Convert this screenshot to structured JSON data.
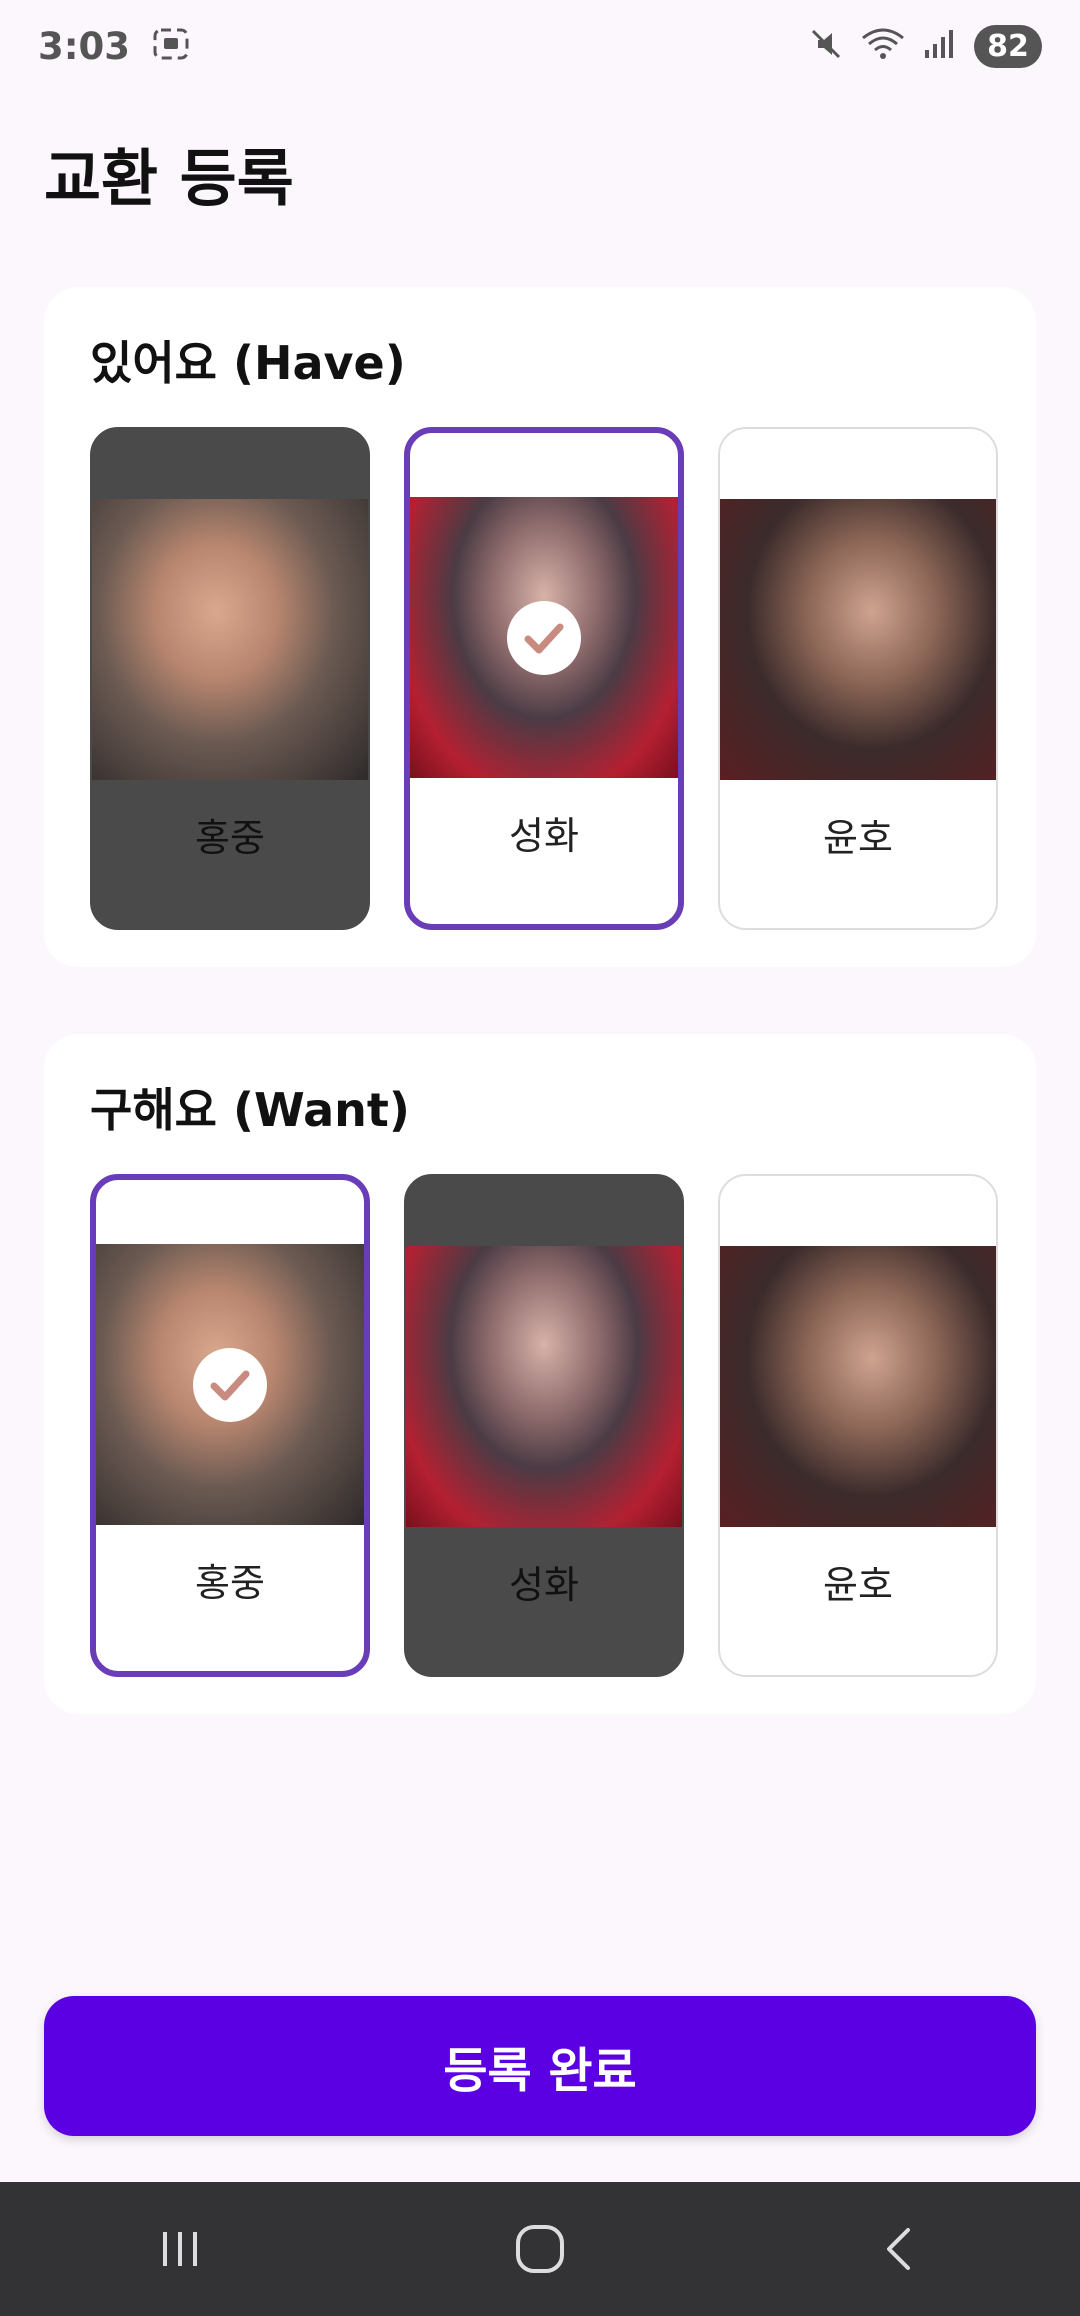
{
  "status_bar": {
    "time": "3:03",
    "battery": "82",
    "icons": [
      "screenshot-icon",
      "mute-icon",
      "wifi-icon",
      "signal-icon"
    ]
  },
  "page": {
    "title": "교환 등록"
  },
  "have_section": {
    "heading": "있어요 (Have)",
    "cards": [
      {
        "name": "홍중",
        "state": "disabled",
        "selected": false
      },
      {
        "name": "성화",
        "state": "normal",
        "selected": true
      },
      {
        "name": "윤호",
        "state": "normal",
        "selected": false
      }
    ]
  },
  "want_section": {
    "heading": "구해요 (Want)",
    "cards": [
      {
        "name": "홍중",
        "state": "normal",
        "selected": true
      },
      {
        "name": "성화",
        "state": "disabled",
        "selected": false
      },
      {
        "name": "윤호",
        "state": "normal",
        "selected": false
      }
    ]
  },
  "submit": {
    "label": "등록 완료"
  },
  "colors": {
    "accent": "#5c00e4",
    "selected_border": "#6a3db8",
    "disabled_card": "#4a4a4a",
    "check": "#c98b7f"
  },
  "nav": [
    "recent-apps-icon",
    "home-icon",
    "back-icon"
  ]
}
